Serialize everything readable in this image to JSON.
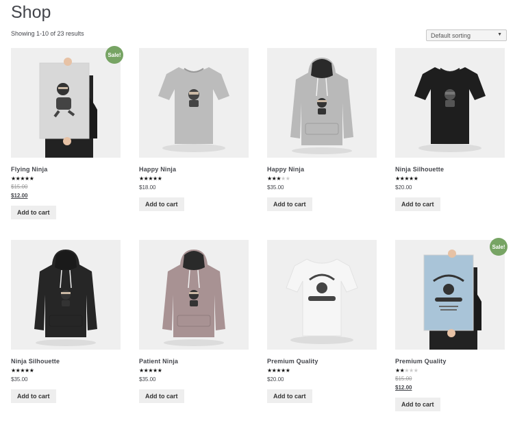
{
  "page": {
    "title": "Shop",
    "result_count": "Showing 1-10 of 23 results",
    "sorting": "Default sorting"
  },
  "products": [
    {
      "title": "Flying Ninja",
      "rating": 4.5,
      "old_price": "$15.00",
      "price": "$12.00",
      "sale": true,
      "sale_label": "Sale!",
      "button": "Add to cart",
      "image": "poster-held"
    },
    {
      "title": "Happy Ninja",
      "rating": 5,
      "old_price": "",
      "price": "$18.00",
      "sale": false,
      "sale_label": "",
      "button": "Add to cart",
      "image": "tshirt-grey"
    },
    {
      "title": "Happy Ninja",
      "rating": 3,
      "old_price": "",
      "price": "$35.00",
      "sale": false,
      "sale_label": "",
      "button": "Add to cart",
      "image": "hoodie-grey"
    },
    {
      "title": "Ninja Silhouette",
      "rating": 5,
      "old_price": "",
      "price": "$20.00",
      "sale": false,
      "sale_label": "",
      "button": "Add to cart",
      "image": "tshirt-black"
    },
    {
      "title": "Ninja Silhouette",
      "rating": 4.5,
      "old_price": "",
      "price": "$35.00",
      "sale": false,
      "sale_label": "",
      "button": "Add to cart",
      "image": "hoodie-black"
    },
    {
      "title": "Patient Ninja",
      "rating": 5,
      "old_price": "",
      "price": "$35.00",
      "sale": false,
      "sale_label": "",
      "button": "Add to cart",
      "image": "hoodie-pink"
    },
    {
      "title": "Premium Quality",
      "rating": 4.5,
      "old_price": "",
      "price": "$20.00",
      "sale": false,
      "sale_label": "",
      "button": "Add to cart",
      "image": "tshirt-white"
    },
    {
      "title": "Premium Quality",
      "rating": 2,
      "old_price": "$15.00",
      "price": "$12.00",
      "sale": true,
      "sale_label": "Sale!",
      "button": "Add to cart",
      "image": "poster-blue"
    }
  ],
  "colors": {
    "sale_badge": "#77a464",
    "text": "#43454b",
    "button_bg": "#eeeeee"
  }
}
